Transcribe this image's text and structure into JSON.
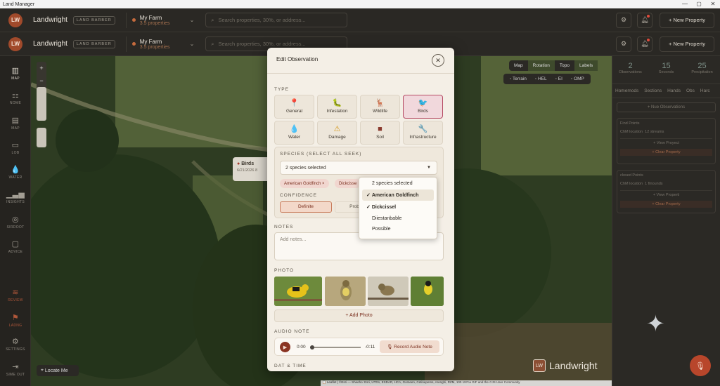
{
  "window": {
    "title": "Land Manager",
    "controls": [
      "—",
      "▢",
      "✕"
    ]
  },
  "header": {
    "logo": "LW",
    "brand": "Landwright",
    "badge": "LAND BARBER",
    "farm_name": "My Farm",
    "farm_sub": "3.5 properties",
    "search_placeholder": "Search properties, 30%, or address...",
    "new_property": "New Property"
  },
  "sidebar": {
    "items": [
      {
        "label": "MAP",
        "icon": "▥"
      },
      {
        "label": "NOME",
        "icon": "⚏"
      },
      {
        "label": "MAP",
        "icon": "▤"
      },
      {
        "label": "LOB",
        "icon": "▭"
      },
      {
        "label": "WATER",
        "icon": "💧"
      },
      {
        "label": "INSIGHTS",
        "icon": "▁▃▅"
      },
      {
        "label": "SIRDOOT",
        "icon": "◎"
      },
      {
        "label": "ADVICE",
        "icon": "▢"
      },
      {
        "label": "REVIEW",
        "icon": "≋"
      },
      {
        "label": "LADNG",
        "icon": "⚑"
      },
      {
        "label": "SETTINGS",
        "icon": "⚙"
      },
      {
        "label": "SIME OUT",
        "icon": "⇥"
      }
    ]
  },
  "map": {
    "tabs": [
      "Map",
      "Rotation",
      "Topo",
      "Labels"
    ],
    "layers": [
      "Terrain",
      "HEL",
      "EI",
      "OMP"
    ],
    "marker_label": "Birds",
    "marker_date": "6/21/2026 8",
    "locate": "Locate Me",
    "watermark": "Landwright",
    "watermark_logo": "LW",
    "attribution": "📋 Leaflet | ©Esri — Sheeho: Esri, UTDn, ESDAR, HCA, Gomeen, Cetinepems, Arenghi, RZM, 100 197ca GIF and the CJS User Community"
  },
  "right_panel": {
    "stats": [
      {
        "value": "2",
        "label": "Observations"
      },
      {
        "value": "15",
        "label": "Seconds"
      },
      {
        "value": "25",
        "label": "Precipitation"
      }
    ],
    "tabs": [
      "Homemods",
      "Sections",
      "Hands",
      "Obs",
      "Harc"
    ],
    "new_obs": "+ Nue Observations",
    "card1": {
      "title": "Find Points",
      "row": "ChM location",
      "value": "12 streams",
      "btn1": "+ View Proyect",
      "btn2": "+ Clear Property"
    },
    "card2": {
      "title": "closed Points",
      "row": "ChM location",
      "value": "1 finounds",
      "btn1": "+ View Properti",
      "btn2": "+ Clear Property"
    }
  },
  "modal": {
    "title": "Edit Observation",
    "type_label": "TYPE",
    "types": [
      {
        "label": "General",
        "icon": "📍"
      },
      {
        "label": "Infestation",
        "icon": "🐛"
      },
      {
        "label": "Wildlife",
        "icon": "🦌"
      },
      {
        "label": "Birds",
        "icon": "🐦"
      },
      {
        "label": "Water",
        "icon": "💧"
      },
      {
        "label": "Damage",
        "icon": "⚠"
      },
      {
        "label": "Soil",
        "icon": "■"
      },
      {
        "label": "Infrastructure",
        "icon": "🔧"
      }
    ],
    "species_label": "SPECIES (SELECT ALL SEEK)",
    "species_value": "2 species selected",
    "chips": [
      "American Goldfinch ×",
      "Dickcisse"
    ],
    "confidence_label": "CONFIDENCE",
    "confidence_options": [
      "Definite",
      "Prob"
    ],
    "dropdown": [
      "2 species selected",
      "American Goldfinch",
      "Dickcissel",
      "Diiestanbable",
      "Possible"
    ],
    "notes_label": "NOTES",
    "notes_placeholder": "Add notes...",
    "photo_label": "PHOTO",
    "add_photo": "+ Add Photo",
    "audio_label": "AUDIO NOTE",
    "audio_time": "0:00",
    "audio_remaining": "-0:11",
    "record_button": "Record Audio Note",
    "date_label": "DAT & TIME"
  },
  "colors": {
    "accent": "#a14a2b",
    "selected": "#b54a63",
    "mic": "#b8462b"
  }
}
